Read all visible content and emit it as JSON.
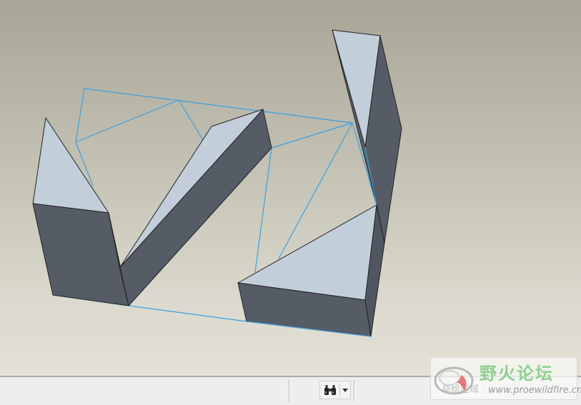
{
  "viewport": {
    "background_top": "#a8a597",
    "background_bottom": "#e3e1d6",
    "face_light_color": "#c2ceda",
    "face_dark_color": "#565c66",
    "sketch_line_color": "#3ba0e0"
  },
  "status_bar": {
    "find_button_icon": "binoculars-icon",
    "selection_filter_value": "草绘区域"
  },
  "watermark": {
    "title": "野火论坛",
    "url": "www.proewildfire.cn",
    "logo_color": "#e05050"
  }
}
